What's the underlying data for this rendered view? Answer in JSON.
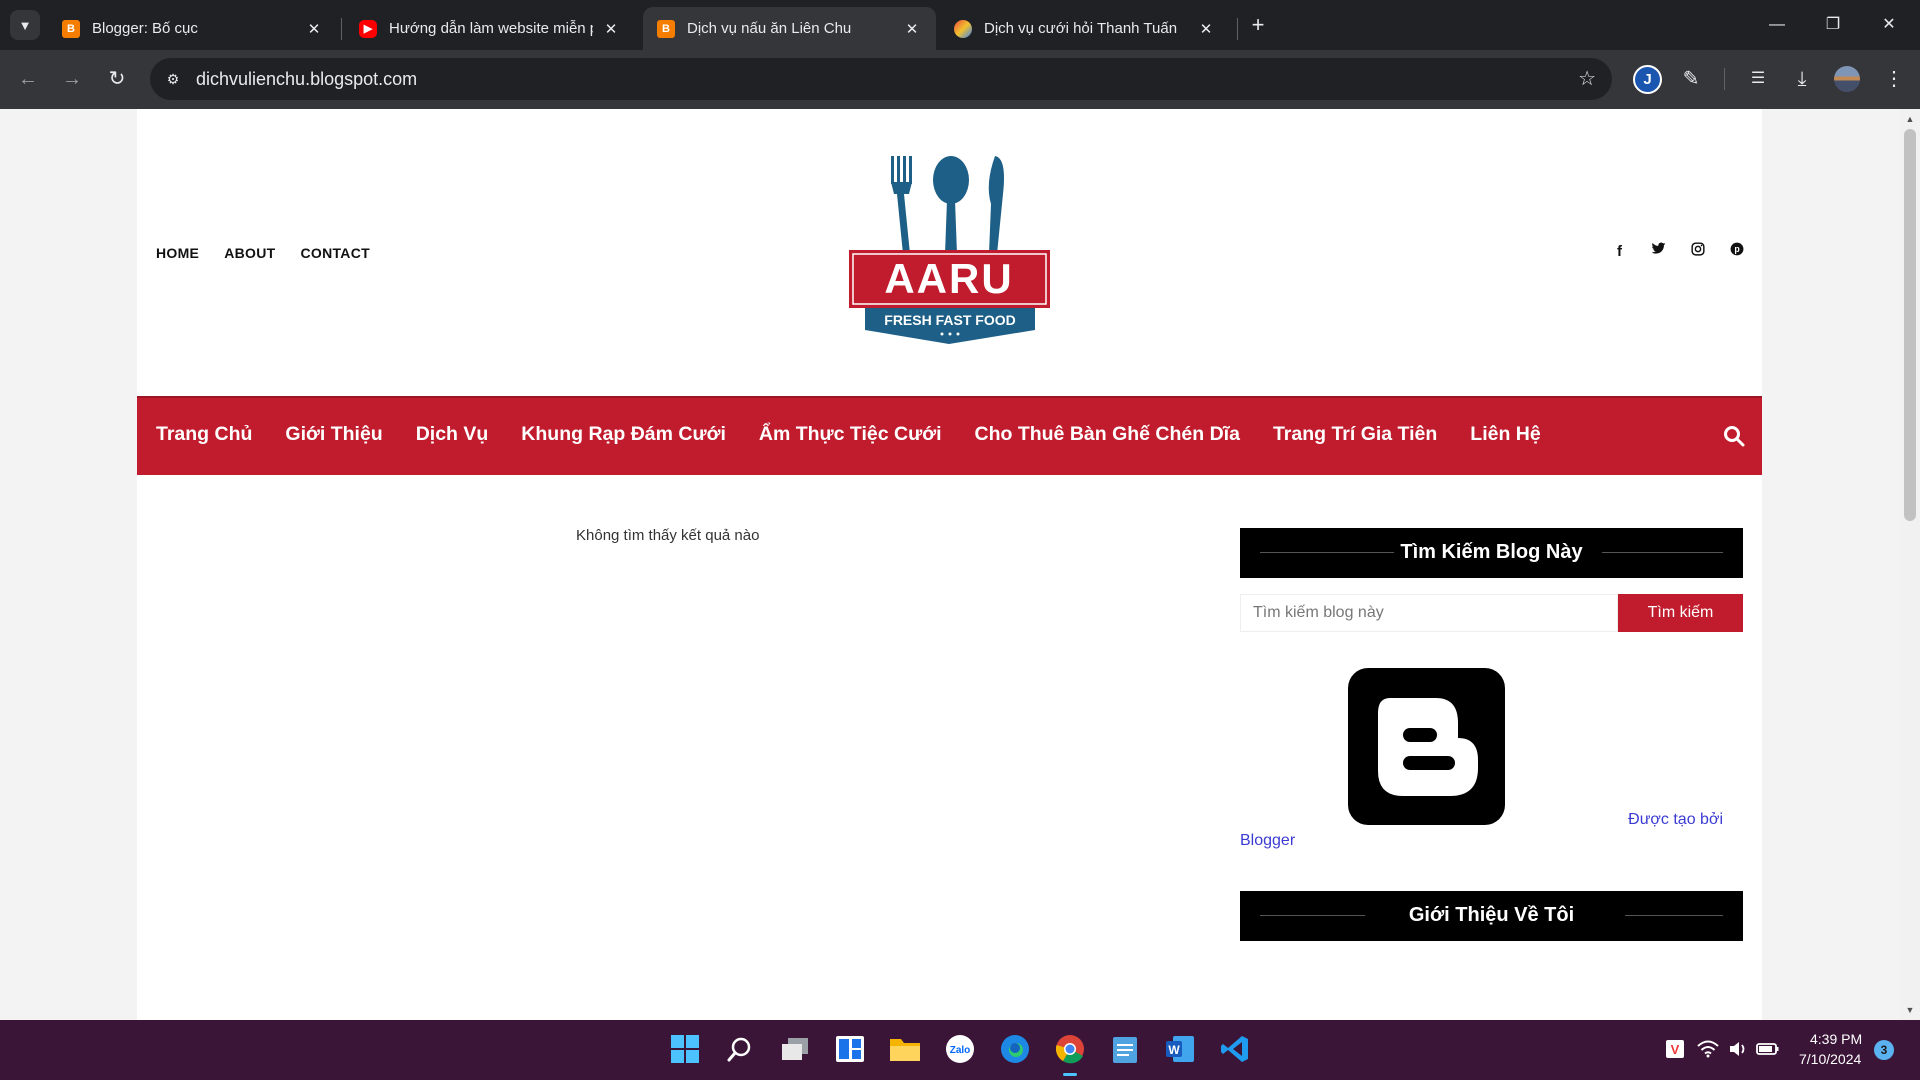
{
  "browser": {
    "tabs": [
      {
        "title": "Blogger: Bố cục",
        "icon": "blogger-icon",
        "active": false
      },
      {
        "title": "Hướng dẫn làm website miễn p",
        "icon": "youtube-icon",
        "active": false
      },
      {
        "title": "Dịch vụ nấu ăn Liên Chu",
        "icon": "blogger-icon",
        "active": true
      },
      {
        "title": "Dịch vụ cưới hỏi Thanh Tuấn",
        "icon": "site-icon",
        "active": false
      }
    ],
    "url": "dichvulienchu.blogspot.com"
  },
  "header": {
    "top_nav": [
      "HOME",
      "ABOUT",
      "CONTACT"
    ],
    "social_icons": [
      "facebook-icon",
      "twitter-icon",
      "instagram-icon",
      "pinterest-icon"
    ],
    "logo": {
      "name": "AARU",
      "tagline": "FRESH FAST FOOD",
      "colors": {
        "red": "#c11c2d",
        "blue": "#1d5f86"
      }
    }
  },
  "main_nav": {
    "items": [
      "Trang Chủ",
      "Giới Thiệu",
      "Dịch Vụ",
      "Khung Rạp Đám Cưới",
      "Ẩm Thực Tiệc Cưới",
      "Cho Thuê Bàn Ghế Chén Dĩa",
      "Trang Trí Gia Tiên",
      "Liên Hệ"
    ],
    "accent": "#c11c2d"
  },
  "content": {
    "no_results": "Không tìm thấy kết quả nào"
  },
  "sidebar": {
    "search_title": "Tìm Kiếm Blog Này",
    "search_placeholder": "Tìm kiếm blog này",
    "search_button": "Tìm kiếm",
    "powered_by": "Được tạo bởi",
    "powered_link": "Blogger",
    "about_title": "Giới Thiệu Về Tôi"
  },
  "taskbar": {
    "time": "4:39 PM",
    "date": "7/10/2024",
    "notifications": "3",
    "apps": [
      "windows-start-icon",
      "search-icon",
      "task-view-icon",
      "widgets-icon",
      "file-explorer-icon",
      "zalo-icon",
      "edge-icon",
      "chrome-icon",
      "notepad-icon",
      "word-icon",
      "vscode-icon"
    ]
  }
}
